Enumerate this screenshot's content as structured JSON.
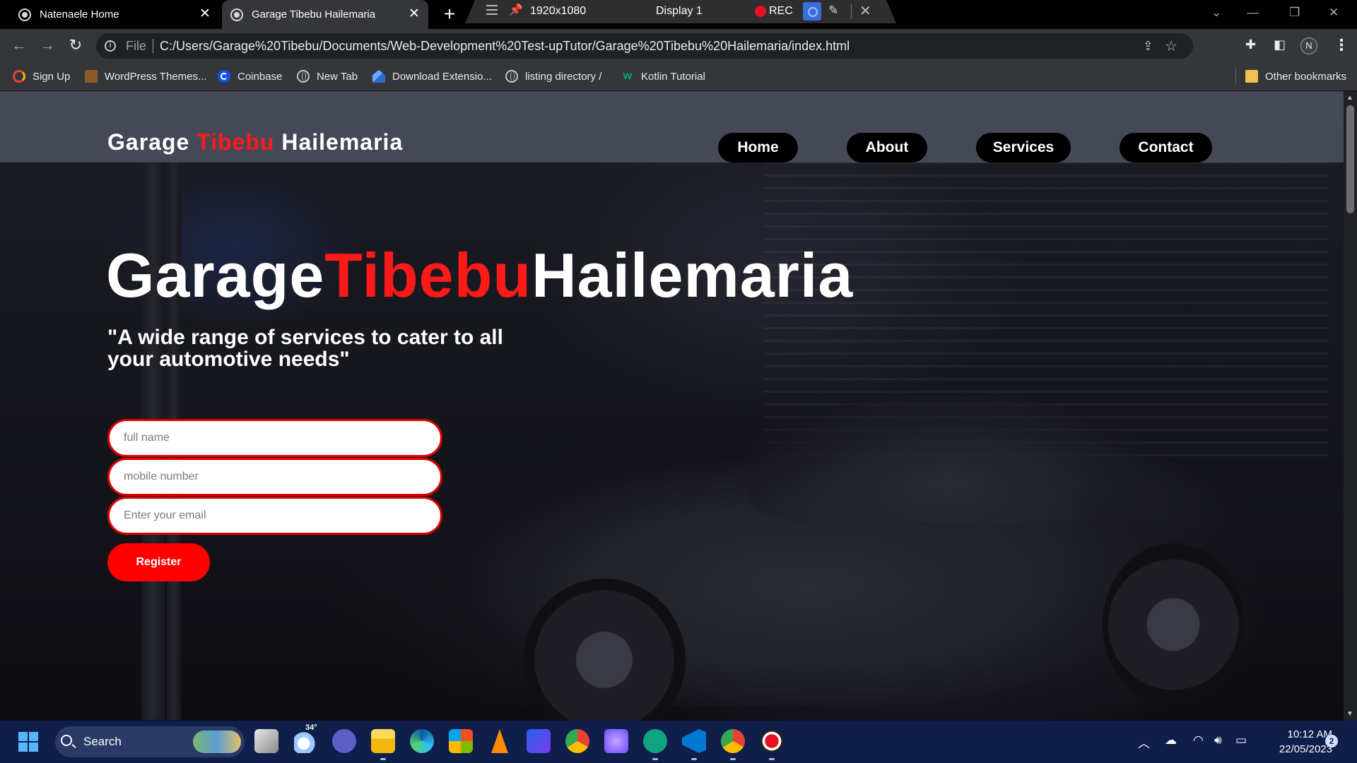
{
  "browser": {
    "tabs": [
      {
        "title": "Natenaele Home",
        "active": false
      },
      {
        "title": "Garage Tibebu Hailemaria",
        "active": true
      }
    ],
    "new_tab_symbol": "+",
    "close_symbol": "✕",
    "recorder": {
      "resolution": "1920x1080",
      "display": "Display 1",
      "rec_label": "REC"
    },
    "address": {
      "scheme": "File",
      "url": "C:/Users/Garage%20Tibebu/Documents/Web-Development%20Test-upTutor/Garage%20Tibebu%20Hailemaria/index.html"
    },
    "profile_initial": "N",
    "bookmarks": [
      {
        "label": "Sign Up",
        "icon": "google-icon"
      },
      {
        "label": "WordPress Themes...",
        "icon": "wordpress-icon"
      },
      {
        "label": "Coinbase",
        "icon": "coinbase-icon"
      },
      {
        "label": "New Tab",
        "icon": "globe-icon"
      },
      {
        "label": "Download Extensio...",
        "icon": "extension-icon"
      },
      {
        "label": "listing directory /",
        "icon": "globe-icon"
      },
      {
        "label": "Kotlin Tutorial",
        "icon": "w3schools-icon"
      }
    ],
    "other_bookmarks": "Other bookmarks"
  },
  "site": {
    "brand": {
      "part1": "Garage",
      "part2": "Tibebu",
      "part3": "Hailemaria"
    },
    "nav": [
      {
        "label": "Home"
      },
      {
        "label": "About"
      },
      {
        "label": "Services"
      },
      {
        "label": "Contact"
      }
    ],
    "hero": {
      "title_part1": "Garage",
      "title_part2": "Tibebu",
      "title_part3": "Hailemaria",
      "subtitle": "\"A wide range of services to cater to all your automotive needs\""
    },
    "form": {
      "full_name_placeholder": "full name",
      "mobile_placeholder": "mobile number",
      "email_placeholder": "Enter your email",
      "register_label": "Register"
    },
    "colors": {
      "accent": "#ff0000",
      "nav_pill": "#000000",
      "header_bg": "#525666"
    }
  },
  "taskbar": {
    "search_label": "Search",
    "temperature": "34°",
    "time": "10:12 AM",
    "date": "22/05/2023",
    "notification_count": "2"
  }
}
